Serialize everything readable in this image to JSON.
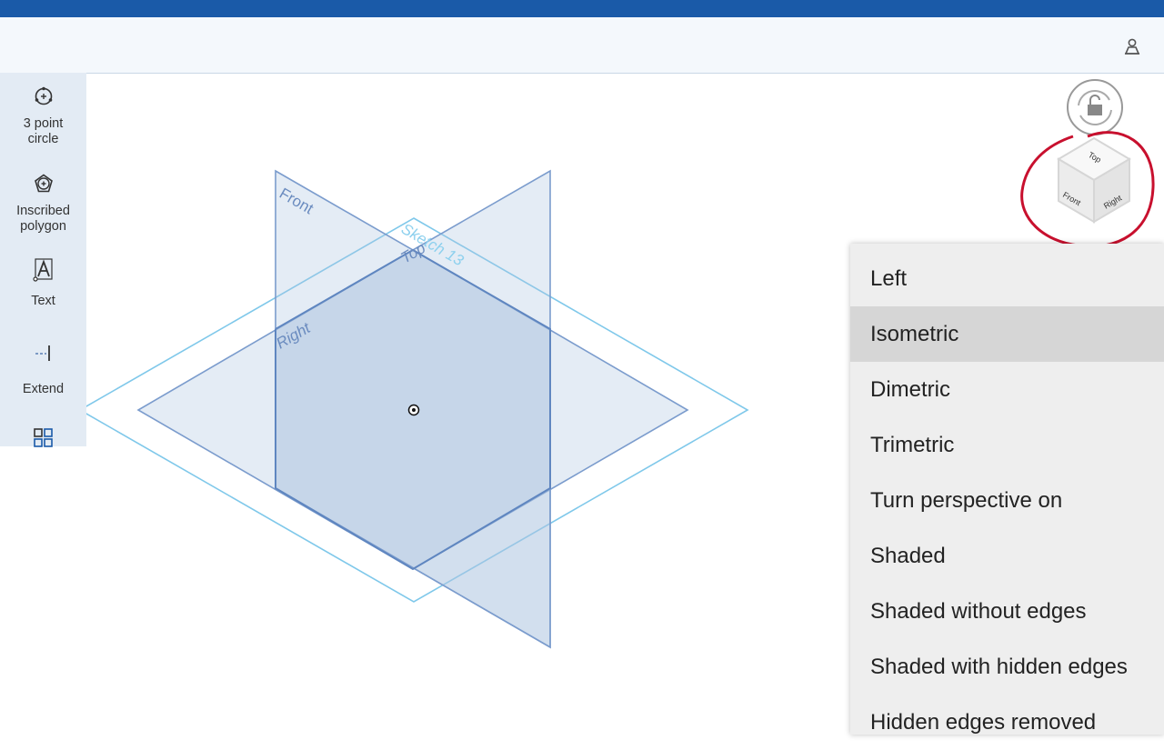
{
  "toolbar": {
    "user_icon": "user-icon"
  },
  "tools": [
    {
      "label_line1": "3 point",
      "label_line2": "circle",
      "icon": "three-point-circle-icon"
    },
    {
      "label_line1": "Inscribed",
      "label_line2": "polygon",
      "icon": "inscribed-polygon-icon"
    },
    {
      "label_line1": "Text",
      "label_line2": "",
      "icon": "text-icon"
    },
    {
      "label_line1": "Extend",
      "label_line2": "",
      "icon": "extend-icon"
    },
    {
      "label_line1": "",
      "label_line2": "",
      "icon": "grid-icon"
    }
  ],
  "canvas": {
    "plane_front": "Front",
    "plane_top": "Top",
    "plane_right": "Right",
    "sketch_label": "Sketch 13"
  },
  "view_cube": {
    "face_top": "Top",
    "face_front": "Front",
    "face_right": "Right"
  },
  "menu": {
    "items": [
      {
        "label": "Left",
        "selected": false
      },
      {
        "label": "Isometric",
        "selected": true
      },
      {
        "label": "Dimetric",
        "selected": false
      },
      {
        "label": "Trimetric",
        "selected": false
      },
      {
        "label": "Turn perspective on",
        "selected": false
      },
      {
        "label": "Shaded",
        "selected": false
      },
      {
        "label": "Shaded without edges",
        "selected": false
      },
      {
        "label": "Shaded with hidden edges",
        "selected": false
      },
      {
        "label": "Hidden edges removed",
        "selected": false
      }
    ]
  },
  "colors": {
    "header": "#1a5aa8",
    "plane_stroke": "#6f95c8",
    "sketch_stroke": "#7fc8ea",
    "annotation": "#c8102e"
  }
}
